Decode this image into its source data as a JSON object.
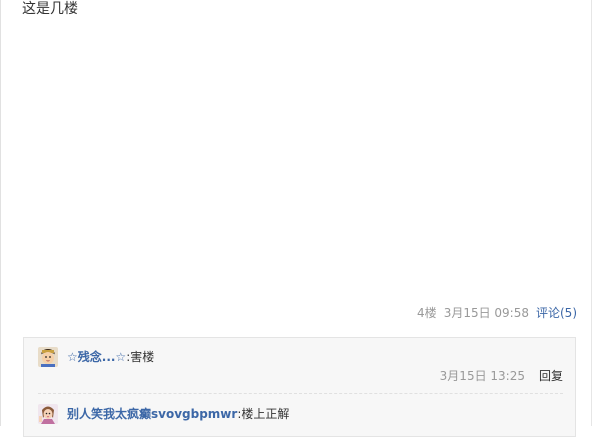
{
  "post": {
    "content": "这是几楼",
    "floor": "4楼",
    "time": "3月15日 09:58",
    "comment_label": "评论(5)"
  },
  "comments": [
    {
      "username": "☆残念...☆",
      "separator": ":",
      "text": "害楼",
      "time": "3月15日 13:25",
      "reply_label": "回复",
      "avatar_icon": "avatar-boy-icon"
    },
    {
      "username": "别人笑我太疯癫svovgbpmwr",
      "separator": ":",
      "text": "楼上正解",
      "avatar_icon": "avatar-girl-icon"
    }
  ],
  "colors": {
    "link": "#3c67a7",
    "meta": "#999999",
    "text": "#333333",
    "comment_bg": "#f7f7f7"
  }
}
